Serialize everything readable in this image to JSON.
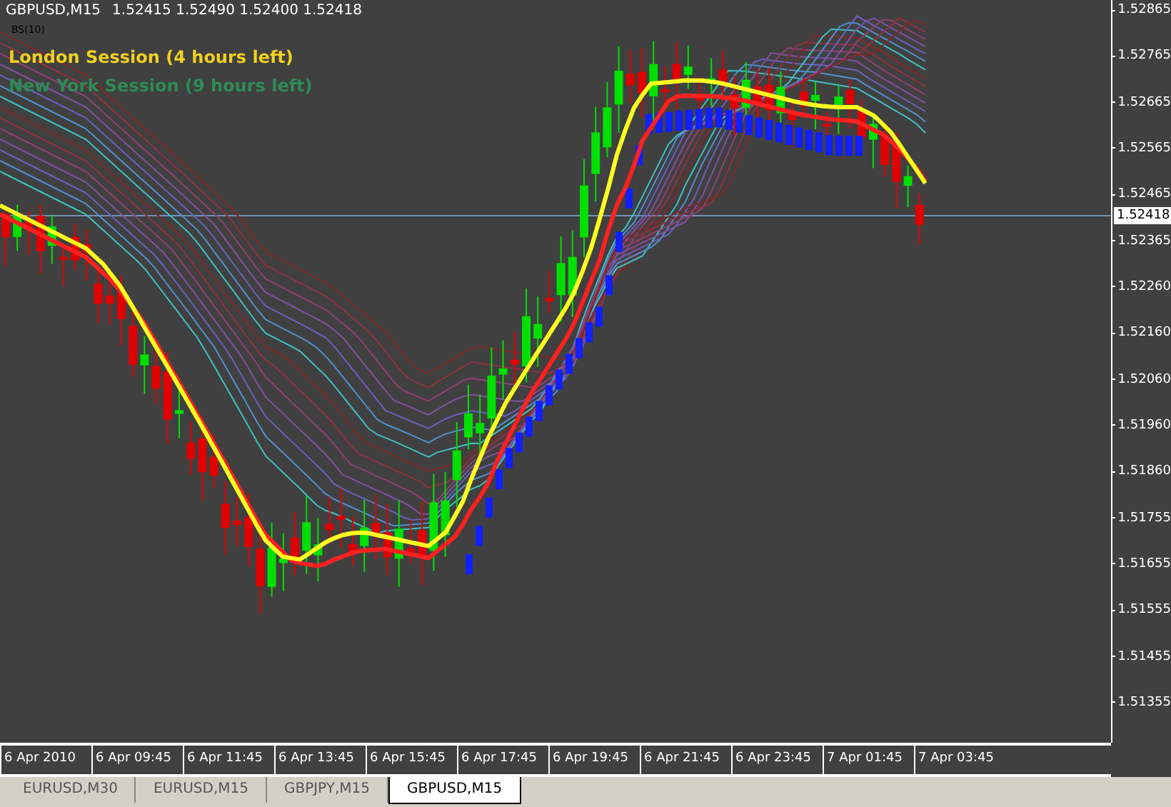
{
  "chart_header": {
    "symbol": "GBPUSD,M15",
    "quotes": "1.52415 1.52490 1.52400 1.52418",
    "indicator": "BS(10)"
  },
  "sessions": [
    {
      "label": "London Session (4 hours left)",
      "color": "#f0d020"
    },
    {
      "label": "New York Session (9 hours left)",
      "color": "#2e8b57"
    }
  ],
  "price_axis": {
    "labels": [
      "1.52865",
      "1.52765",
      "1.52665",
      "1.52565",
      "1.52465",
      "1.52365",
      "1.52260",
      "1.52160",
      "1.52060",
      "1.51960",
      "1.51860",
      "1.51755",
      "1.51655",
      "1.51555",
      "1.51455",
      "1.51355"
    ],
    "current_price": "1.52418"
  },
  "time_axis": [
    "6 Apr 2010",
    "6 Apr 09:45",
    "6 Apr 11:45",
    "6 Apr 13:45",
    "6 Apr 15:45",
    "6 Apr 17:45",
    "6 Apr 19:45",
    "6 Apr 21:45",
    "6 Apr 23:45",
    "7 Apr 01:45",
    "7 Apr 03:45"
  ],
  "tabs": [
    {
      "label": "EURUSD,M30",
      "selected": false
    },
    {
      "label": "EURUSD,M15",
      "selected": false
    },
    {
      "label": "GBPJPY,M15",
      "selected": false
    },
    {
      "label": "GBPUSD,M15",
      "selected": true
    }
  ]
}
